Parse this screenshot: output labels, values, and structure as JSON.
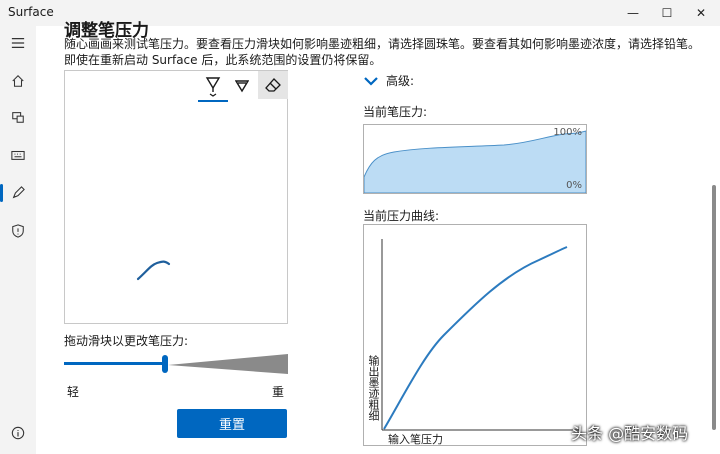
{
  "window": {
    "title": "Surface",
    "controls": [
      "—",
      "☐",
      "✕"
    ]
  },
  "sidebar": {
    "items": [
      {
        "icon": "menu-icon"
      },
      {
        "icon": "home-icon"
      },
      {
        "icon": "devices-icon"
      },
      {
        "icon": "keyboard-icon"
      },
      {
        "icon": "pen-icon",
        "active": true
      },
      {
        "icon": "shield-icon"
      },
      {
        "icon": "info-icon"
      }
    ]
  },
  "main": {
    "heading": "调整笔压力",
    "description": "随心画画来测试笔压力。要查看压力滑块如何影响墨迹粗细，请选择圆珠笔。要查看其如何影响墨迹浓度，请选择铅笔。即使在重新启动 Surface 后，此系统范围的设置仍将保留。",
    "tools": [
      "ballpoint-pen-icon",
      "pencil-icon",
      "eraser-icon"
    ],
    "slider": {
      "label": "拖动滑块以更改笔压力:",
      "value": 0.44,
      "min_label": "轻",
      "max_label": "重"
    },
    "reset_button": "重置"
  },
  "advanced": {
    "label": "高级:",
    "current_pressure_label": "当前笔压力:",
    "pressure_max": "100%",
    "pressure_min": "0%",
    "curve_label": "当前压力曲线:",
    "curve_y_label": "输出墨迹粗细",
    "curve_x_label": "输入笔压力"
  },
  "watermark": "头条 @酷安数码",
  "colors": {
    "accent": "#0067c0",
    "graph_fill": "#bcdcf4"
  }
}
